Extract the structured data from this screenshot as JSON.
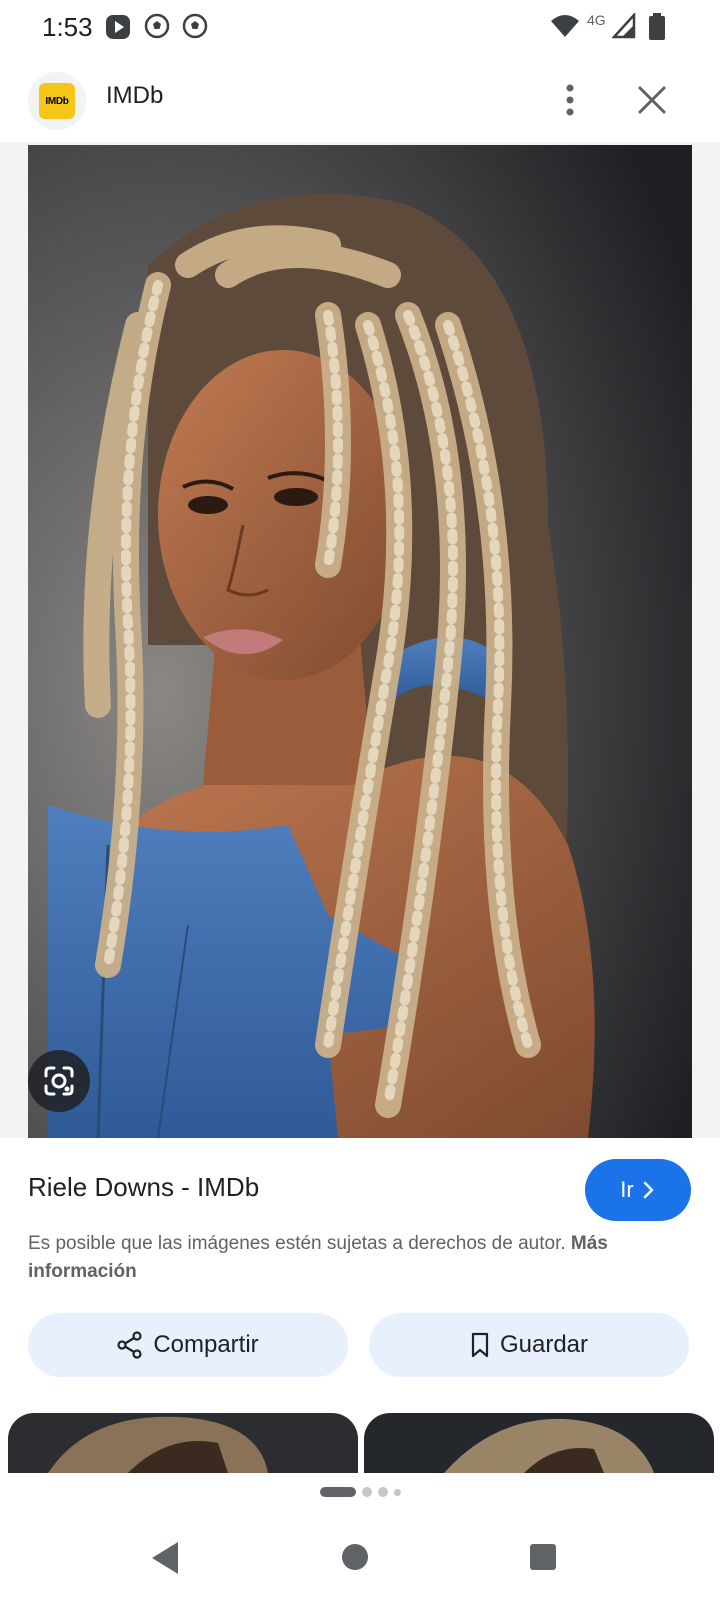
{
  "status_bar": {
    "time": "1:53",
    "network": "4G",
    "icons": [
      "play-icon",
      "soccer-ball-icon",
      "soccer-ball-icon",
      "wifi-icon",
      "signal-icon",
      "battery-icon"
    ]
  },
  "header": {
    "logo_text": "IMDb",
    "site_name": "IMDb",
    "menu_icon": "more-vert-icon",
    "close_icon": "close-icon"
  },
  "result": {
    "title": "Riele Downs - IMDb",
    "visit_label": "Ir",
    "copyright_text": "Es posible que las imágenes estén sujetas a derechos de autor.",
    "more_info_label": "Más información"
  },
  "actions": {
    "share_label": "Compartir",
    "save_label": "Guardar"
  },
  "pager": {
    "active_index": 0,
    "count": 4
  },
  "navbar": {
    "icons": [
      "back-icon",
      "home-icon",
      "recents-icon"
    ]
  },
  "colors": {
    "accent": "#1a73e8",
    "action_bg": "#e8f0fe",
    "imdb_yellow": "#f5c518"
  }
}
